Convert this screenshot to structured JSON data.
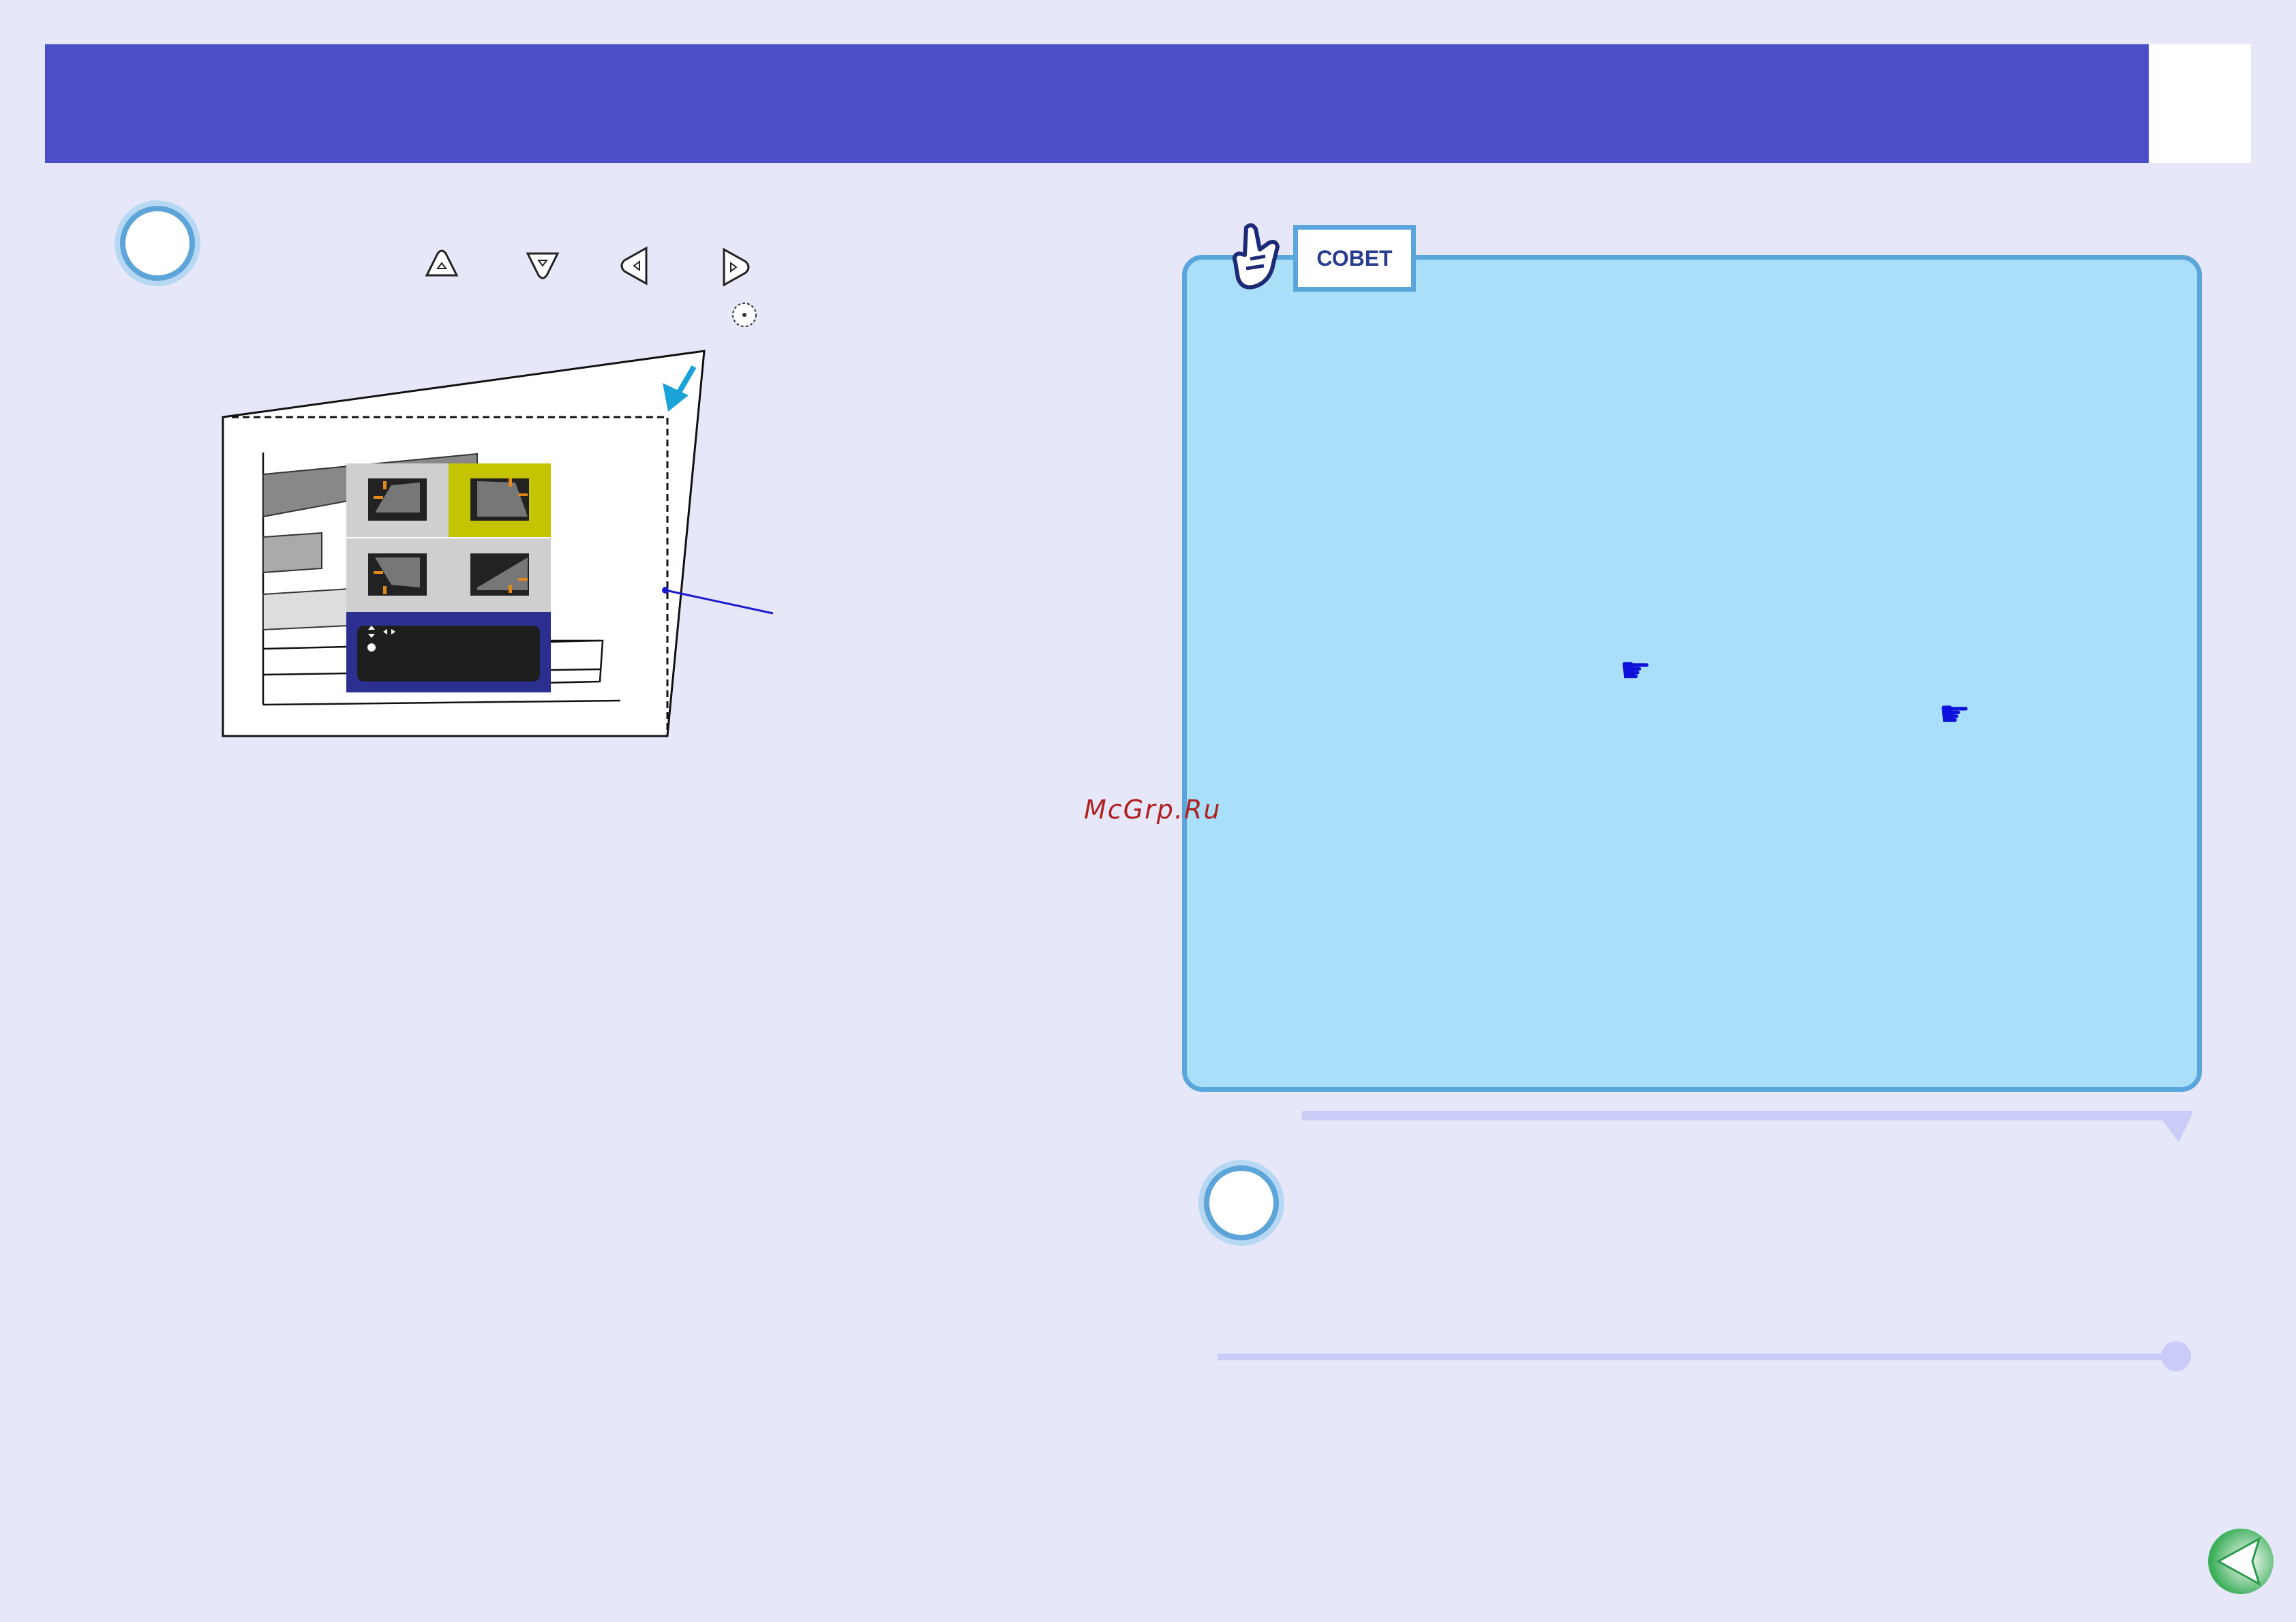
{
  "tip": {
    "label": "СОВЕТ"
  },
  "watermark": "McGrp.Ru",
  "icons": {
    "up": "up-arrow-button-icon",
    "down": "down-arrow-button-icon",
    "left": "left-arrow-button-icon",
    "right": "right-arrow-button-icon",
    "enter": "enter-button-icon",
    "hint": "pointing-hand-icon",
    "reference": "pointing-finger-icon",
    "back": "back-arrow-icon"
  },
  "colors": {
    "header": "#4c4ec8",
    "page_background": "#e6e8fa",
    "tip_panel": "#a9dff8",
    "tip_border": "#5aa6dc",
    "menu_highlight": "#c4c400",
    "menu_bar": "#2b2f8f",
    "reference_icon": "#1010dd"
  }
}
